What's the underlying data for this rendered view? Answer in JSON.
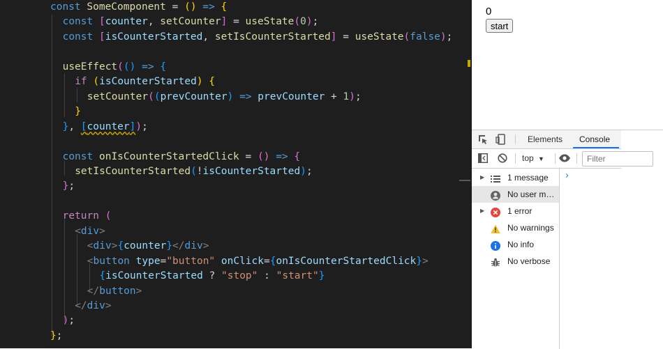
{
  "editor": {
    "lines": [
      [
        [
          "kw",
          "const "
        ],
        [
          "fn",
          "SomeComponent"
        ],
        [
          "pl",
          " = "
        ],
        [
          "b1",
          "()"
        ],
        [
          "pl",
          " "
        ],
        [
          "kw",
          "=>"
        ],
        [
          "pl",
          " "
        ],
        [
          "b1",
          "{"
        ]
      ],
      [
        [
          "kw",
          "const "
        ],
        [
          "b2",
          "["
        ],
        [
          "vr",
          "counter"
        ],
        [
          "pl",
          ", "
        ],
        [
          "fn",
          "setCounter"
        ],
        [
          "b2",
          "]"
        ],
        [
          "pl",
          " = "
        ],
        [
          "fn",
          "useState"
        ],
        [
          "b2",
          "("
        ],
        [
          "nm",
          "0"
        ],
        [
          "b2",
          ")"
        ],
        [
          "pl",
          ";"
        ]
      ],
      [
        [
          "kw",
          "const "
        ],
        [
          "b2",
          "["
        ],
        [
          "vr",
          "isCounterStarted"
        ],
        [
          "pl",
          ", "
        ],
        [
          "fn",
          "setIsCounterStarted"
        ],
        [
          "b2",
          "]"
        ],
        [
          "pl",
          " = "
        ],
        [
          "fn",
          "useState"
        ],
        [
          "b2",
          "("
        ],
        [
          "kw",
          "false"
        ],
        [
          "b2",
          ")"
        ],
        [
          "pl",
          ";"
        ]
      ],
      [],
      [
        [
          "fn",
          "useEffect"
        ],
        [
          "b2",
          "("
        ],
        [
          "b3",
          "()"
        ],
        [
          "pl",
          " "
        ],
        [
          "kw",
          "=>"
        ],
        [
          "pl",
          " "
        ],
        [
          "b3",
          "{"
        ]
      ],
      [
        [
          "ct",
          "if "
        ],
        [
          "b1",
          "("
        ],
        [
          "vr",
          "isCounterStarted"
        ],
        [
          "b1",
          ")"
        ],
        [
          "pl",
          " "
        ],
        [
          "b1",
          "{"
        ]
      ],
      [
        [
          "fn",
          "setCounter"
        ],
        [
          "b2",
          "("
        ],
        [
          "b3",
          "("
        ],
        [
          "vr",
          "prevCounter"
        ],
        [
          "b3",
          ")"
        ],
        [
          "pl",
          " "
        ],
        [
          "kw",
          "=>"
        ],
        [
          "pl",
          " "
        ],
        [
          "vr",
          "prevCounter"
        ],
        [
          "pl",
          " + "
        ],
        [
          "nm",
          "1"
        ],
        [
          "b2",
          ")"
        ],
        [
          "pl",
          ";"
        ]
      ],
      [
        [
          "b1",
          "}"
        ]
      ],
      [
        [
          "b3",
          "}"
        ],
        [
          "pl",
          ", "
        ],
        [
          "b3sq",
          "["
        ],
        [
          "vrsq",
          "counter"
        ],
        [
          "b3sq",
          "]"
        ],
        [
          "b2",
          ")"
        ],
        [
          "pl",
          ";"
        ]
      ],
      [],
      [
        [
          "kw",
          "const "
        ],
        [
          "fn",
          "onIsCounterStartedClick"
        ],
        [
          "pl",
          " = "
        ],
        [
          "b2",
          "()"
        ],
        [
          "pl",
          " "
        ],
        [
          "kw",
          "=>"
        ],
        [
          "pl",
          " "
        ],
        [
          "b2",
          "{"
        ]
      ],
      [
        [
          "fn",
          "setIsCounterStarted"
        ],
        [
          "b3",
          "("
        ],
        [
          "pl",
          "!"
        ],
        [
          "vr",
          "isCounterStarted"
        ],
        [
          "b3",
          ")"
        ],
        [
          "pl",
          ";"
        ]
      ],
      [
        [
          "b2",
          "}"
        ],
        [
          "pl",
          ";"
        ]
      ],
      [],
      [
        [
          "ct",
          "return "
        ],
        [
          "b2",
          "("
        ]
      ],
      [
        [
          "tg",
          "<"
        ],
        [
          "tn",
          "div"
        ],
        [
          "tg",
          ">"
        ]
      ],
      [
        [
          "tg",
          "<"
        ],
        [
          "tn",
          "div"
        ],
        [
          "tg",
          ">"
        ],
        [
          "b3",
          "{"
        ],
        [
          "vr",
          "counter"
        ],
        [
          "b3",
          "}"
        ],
        [
          "tg",
          "</"
        ],
        [
          "tn",
          "div"
        ],
        [
          "tg",
          ">"
        ]
      ],
      [
        [
          "tg",
          "<"
        ],
        [
          "tn",
          "button"
        ],
        [
          "pl",
          " "
        ],
        [
          "at",
          "type"
        ],
        [
          "pl",
          "="
        ],
        [
          "st",
          "\"button\""
        ],
        [
          "pl",
          " "
        ],
        [
          "at",
          "onClick"
        ],
        [
          "pl",
          "="
        ],
        [
          "b3",
          "{"
        ],
        [
          "vr",
          "onIsCounterStartedClick"
        ],
        [
          "b3",
          "}"
        ],
        [
          "tg",
          ">"
        ]
      ],
      [
        [
          "b3",
          "{"
        ],
        [
          "vr",
          "isCounterStarted"
        ],
        [
          "pl",
          " ? "
        ],
        [
          "st",
          "\"stop\""
        ],
        [
          "pl",
          " : "
        ],
        [
          "st",
          "\"start\""
        ],
        [
          "b3",
          "}"
        ]
      ],
      [
        [
          "tg",
          "</"
        ],
        [
          "tn",
          "button"
        ],
        [
          "tg",
          ">"
        ]
      ],
      [
        [
          "tg",
          "</"
        ],
        [
          "tn",
          "div"
        ],
        [
          "tg",
          ">"
        ]
      ],
      [
        [
          "b2",
          ")"
        ],
        [
          "pl",
          ";"
        ]
      ],
      [
        [
          "b1",
          "}"
        ],
        [
          "pl",
          ";"
        ]
      ]
    ]
  },
  "app": {
    "counter_value": "0",
    "button_label": "start"
  },
  "devtools": {
    "tabs": [
      "Elements",
      "Console"
    ],
    "active_tab": "Console",
    "context": "top",
    "filter_placeholder": "Filter",
    "sidebar": [
      {
        "label": "1 message",
        "icon": "list-icon",
        "expandable": true,
        "selected": false
      },
      {
        "label": "No user messages",
        "icon": "user-icon",
        "expandable": false,
        "selected": true
      },
      {
        "label": "1 error",
        "icon": "error-icon",
        "expandable": true,
        "selected": false
      },
      {
        "label": "No warnings",
        "icon": "warning-icon",
        "expandable": false,
        "selected": false
      },
      {
        "label": "No info",
        "icon": "info-icon",
        "expandable": false,
        "selected": false
      },
      {
        "label": "No verbose",
        "icon": "verbose-icon",
        "expandable": false,
        "selected": false
      }
    ],
    "colors": {
      "accent": "#1a73e8",
      "error": "#e8453c",
      "warning": "#f2c037",
      "info": "#1a73e8"
    }
  }
}
